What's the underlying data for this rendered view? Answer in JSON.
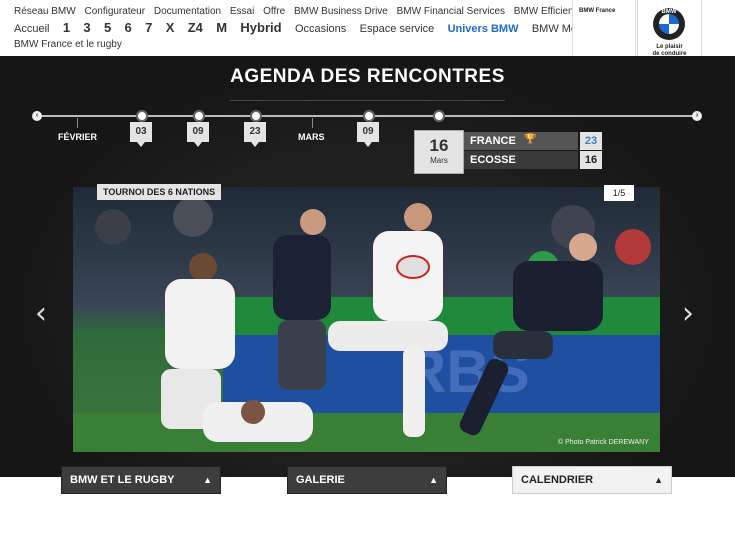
{
  "nav": {
    "row1": [
      "Réseau BMW",
      "Configurateur",
      "Documentation",
      "Essai",
      "Offre",
      "BMW Business Drive",
      "BMW Financial Services",
      "BMW EfficientDynamics"
    ],
    "row2": {
      "accueil": "Accueil",
      "models": [
        "1",
        "3",
        "5",
        "6",
        "7",
        "X",
        "Z4",
        "M",
        "Hybrid"
      ],
      "occasions": "Occasions",
      "espace": "Espace service",
      "univers": "Univers BMW",
      "motorrad": "BMW Motorrad"
    },
    "row3": "BMW France et le rugby"
  },
  "brand": {
    "label": "BMW France",
    "roundel": "BMW",
    "slogan_line1": "Le plaisir",
    "slogan_line2": "de conduire"
  },
  "agenda": {
    "title": "AGENDA DES RENCONTRES",
    "months": [
      "FÉVRIER",
      "MARS"
    ],
    "dates": [
      "03",
      "09",
      "23",
      "09"
    ],
    "selected": {
      "day": "16",
      "month": "Mars"
    },
    "team1": {
      "name": "FRANCE",
      "score": "23"
    },
    "team2": {
      "name": "ECOSSE",
      "score": "16"
    },
    "prev_icon": "chevron-left-icon",
    "next_icon": "chevron-right-icon"
  },
  "photo": {
    "tag": "TOURNOI DES 6 NATIONS",
    "counter": "1/5",
    "credit": "© Photo Patrick DEREWANY"
  },
  "buttons": {
    "rugby": "BMW ET LE RUGBY",
    "galerie": "GALERIE",
    "calendrier": "CALENDRIER"
  }
}
